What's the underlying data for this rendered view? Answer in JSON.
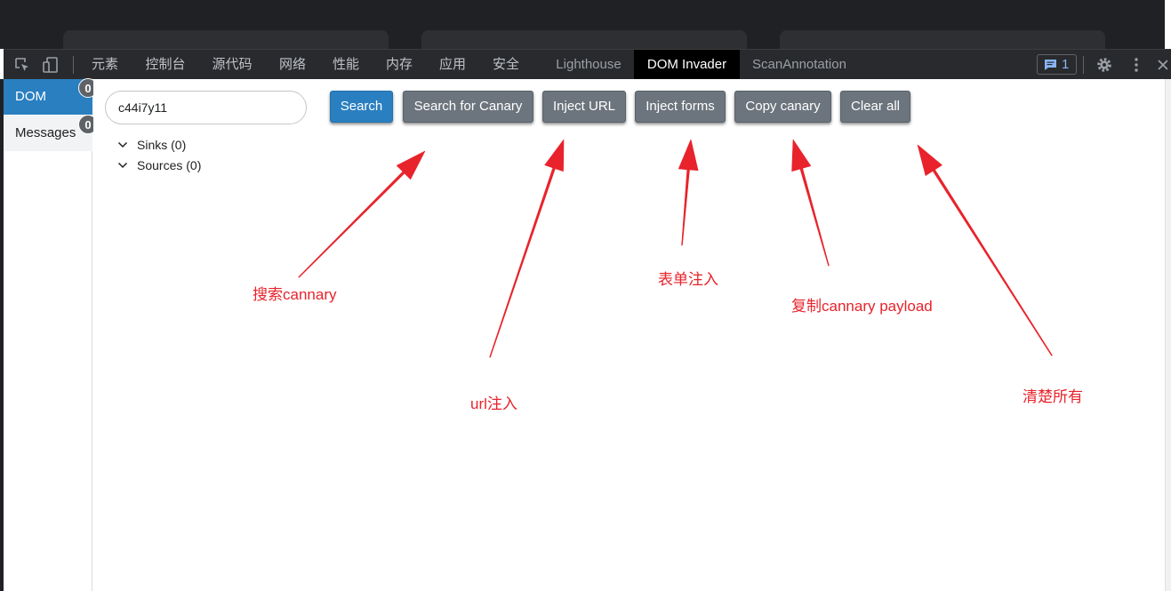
{
  "devtools": {
    "tabs": [
      {
        "label": "元素"
      },
      {
        "label": "控制台"
      },
      {
        "label": "源代码"
      },
      {
        "label": "网络"
      },
      {
        "label": "性能"
      },
      {
        "label": "内存"
      },
      {
        "label": "应用"
      },
      {
        "label": "安全"
      },
      {
        "label": "Lighthouse"
      },
      {
        "label": "DOM Invader"
      },
      {
        "label": "ScanAnnotation"
      }
    ],
    "active_tab": "DOM Invader",
    "issues_count": "1"
  },
  "sidebar": {
    "items": [
      {
        "label": "DOM",
        "badge": "0"
      },
      {
        "label": "Messages",
        "badge": "0"
      }
    ]
  },
  "toolbar": {
    "canary_value": "c44i7y11",
    "search_label": "Search",
    "search_canary_label": "Search for Canary",
    "inject_url_label": "Inject URL",
    "inject_forms_label": "Inject forms",
    "copy_canary_label": "Copy canary",
    "clear_all_label": "Clear all"
  },
  "tree": {
    "sinks_label": "Sinks (0)",
    "sources_label": "Sources (0)"
  },
  "annotations": {
    "color": "#e8232b",
    "search_canary": "搜索cannary",
    "inject_url": "url注入",
    "inject_forms": "表单注入",
    "copy_canary": "复制cannary payload",
    "clear_all": "清楚所有"
  },
  "colors": {
    "accent": "#2a7fc0",
    "button_gray": "#6c757d",
    "devtools_bg": "#292a2d"
  }
}
